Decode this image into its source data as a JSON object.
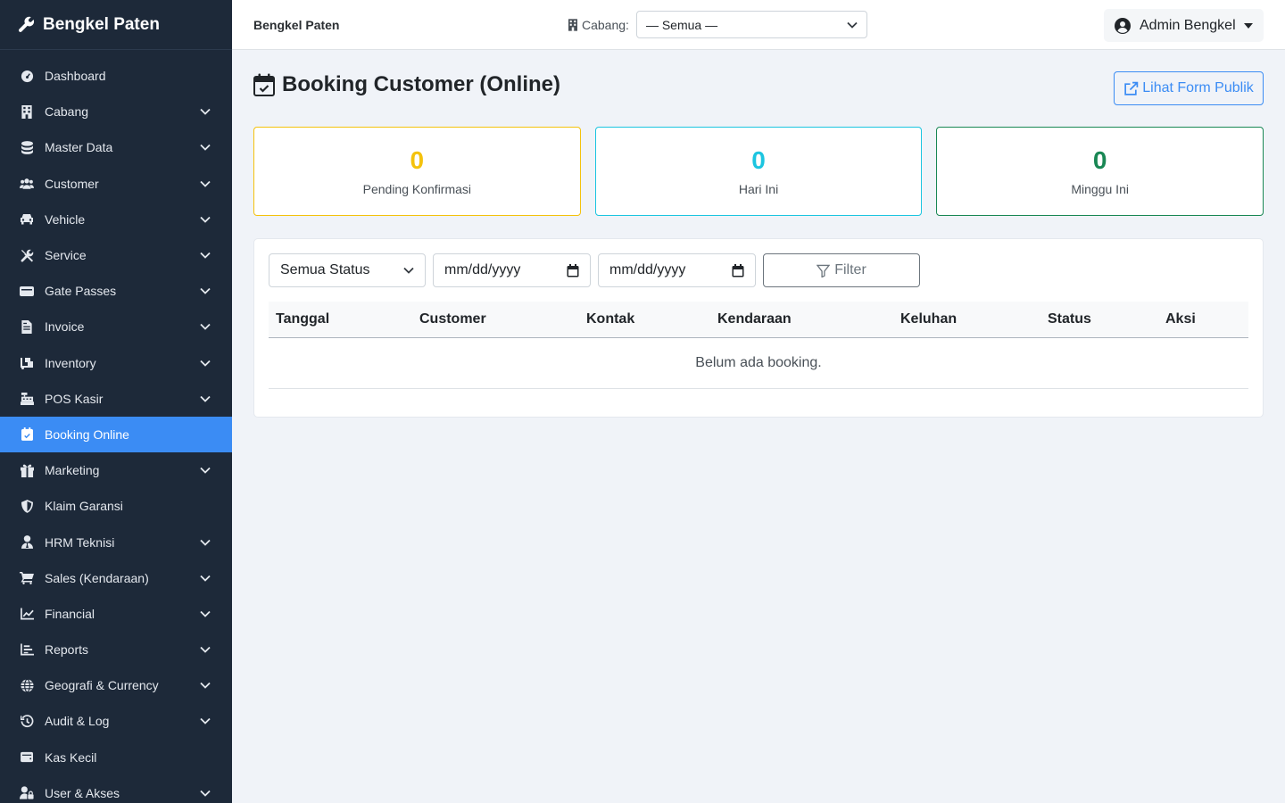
{
  "brand": {
    "name": "Bengkel Paten"
  },
  "sidebar": {
    "items": [
      {
        "label": "Dashboard",
        "icon": "gauge-icon",
        "has_chevron": false
      },
      {
        "label": "Cabang",
        "icon": "building-icon",
        "has_chevron": true
      },
      {
        "label": "Master Data",
        "icon": "database-icon",
        "has_chevron": true
      },
      {
        "label": "Customer",
        "icon": "users-icon",
        "has_chevron": true
      },
      {
        "label": "Vehicle",
        "icon": "car-icon",
        "has_chevron": true
      },
      {
        "label": "Service",
        "icon": "tools-icon",
        "has_chevron": true
      },
      {
        "label": "Gate Passes",
        "icon": "gate-pass-icon",
        "has_chevron": true
      },
      {
        "label": "Invoice",
        "icon": "file-invoice-icon",
        "has_chevron": true
      },
      {
        "label": "Inventory",
        "icon": "dolly-icon",
        "has_chevron": true
      },
      {
        "label": "POS Kasir",
        "icon": "cash-register-icon",
        "has_chevron": true
      },
      {
        "label": "Booking Online",
        "icon": "calendar-check-icon",
        "has_chevron": false,
        "active": true
      },
      {
        "label": "Marketing",
        "icon": "gift-icon",
        "has_chevron": true
      },
      {
        "label": "Klaim Garansi",
        "icon": "shield-icon",
        "has_chevron": false
      },
      {
        "label": "HRM Teknisi",
        "icon": "user-tie-icon",
        "has_chevron": true
      },
      {
        "label": "Sales (Kendaraan)",
        "icon": "cart-icon",
        "has_chevron": true
      },
      {
        "label": "Financial",
        "icon": "chart-line-icon",
        "has_chevron": true
      },
      {
        "label": "Reports",
        "icon": "chart-bar-icon",
        "has_chevron": true
      },
      {
        "label": "Geografi & Currency",
        "icon": "globe-icon",
        "has_chevron": true
      },
      {
        "label": "Audit & Log",
        "icon": "history-icon",
        "has_chevron": true
      },
      {
        "label": "Kas Kecil",
        "icon": "wallet-icon",
        "has_chevron": false
      },
      {
        "label": "User & Akses",
        "icon": "user-lock-icon",
        "has_chevron": true
      }
    ]
  },
  "topbar": {
    "title": "Bengkel Paten",
    "branch_label": "Cabang:",
    "branch_value": "— Semua —",
    "user_name": "Admin Bengkel"
  },
  "page": {
    "title": "Booking Customer (Online)",
    "public_form_button": "Lihat Form Publik"
  },
  "stats": {
    "pending": {
      "value": "0",
      "label": "Pending Konfirmasi"
    },
    "today": {
      "value": "0",
      "label": "Hari Ini"
    },
    "week": {
      "value": "0",
      "label": "Minggu Ini"
    }
  },
  "filters": {
    "status_value": "Semua Status",
    "date_from_placeholder": "mm/dd/yyyy",
    "date_to_placeholder": "mm/dd/yyyy",
    "filter_button": "Filter"
  },
  "table": {
    "headers": [
      "Tanggal",
      "Customer",
      "Kontak",
      "Kendaraan",
      "Keluhan",
      "Status",
      "Aksi"
    ],
    "empty_message": "Belum ada booking."
  },
  "colors": {
    "sidebar_bg": "#1d2939",
    "active": "#3b8cf4",
    "warning": "#f4c20d",
    "info": "#1cc5e0",
    "success": "#198754"
  }
}
